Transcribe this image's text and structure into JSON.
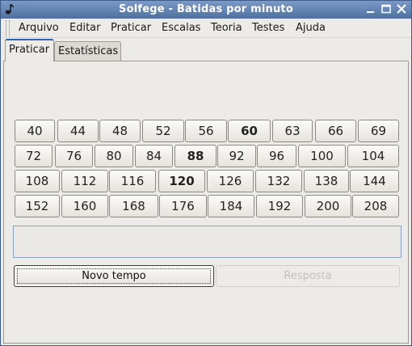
{
  "window": {
    "title": "Solfege - Batidas por minuto",
    "titlebar_color": "#5a7aae"
  },
  "menu": [
    {
      "name": "menu-arquivo",
      "label": "Arquivo"
    },
    {
      "name": "menu-editar",
      "label": "Editar"
    },
    {
      "name": "menu-praticar",
      "label": "Praticar"
    },
    {
      "name": "menu-escalas",
      "label": "Escalas"
    },
    {
      "name": "menu-teoria",
      "label": "Teoria"
    },
    {
      "name": "menu-testes",
      "label": "Testes"
    },
    {
      "name": "menu-ajuda",
      "label": "Ajuda"
    }
  ],
  "tabs": [
    {
      "label": "Praticar",
      "active": true
    },
    {
      "label": "Estatísticas",
      "active": false
    }
  ],
  "bpm_rows": [
    [
      {
        "label": "40"
      },
      {
        "label": "44"
      },
      {
        "label": "48"
      },
      {
        "label": "52"
      },
      {
        "label": "56"
      },
      {
        "label": "60",
        "bold": true
      },
      {
        "label": "63"
      },
      {
        "label": "66"
      },
      {
        "label": "69"
      }
    ],
    [
      {
        "label": "72"
      },
      {
        "label": "76"
      },
      {
        "label": "80"
      },
      {
        "label": "84"
      },
      {
        "label": "88",
        "bold": true
      },
      {
        "label": "92"
      },
      {
        "label": "96"
      },
      {
        "label": "100"
      },
      {
        "label": "104"
      }
    ],
    [
      {
        "label": "108"
      },
      {
        "label": "112"
      },
      {
        "label": "116"
      },
      {
        "label": "120",
        "bold": true
      },
      {
        "label": "126"
      },
      {
        "label": "132"
      },
      {
        "label": "138"
      },
      {
        "label": "144"
      }
    ],
    [
      {
        "label": "152"
      },
      {
        "label": "160"
      },
      {
        "label": "168"
      },
      {
        "label": "176"
      },
      {
        "label": "184"
      },
      {
        "label": "192"
      },
      {
        "label": "200"
      },
      {
        "label": "208"
      }
    ]
  ],
  "answer_display": {
    "value": ""
  },
  "buttons": {
    "new_tempo": {
      "label": "Novo tempo",
      "enabled": true
    },
    "answer": {
      "label": "Resposta",
      "enabled": false
    }
  }
}
